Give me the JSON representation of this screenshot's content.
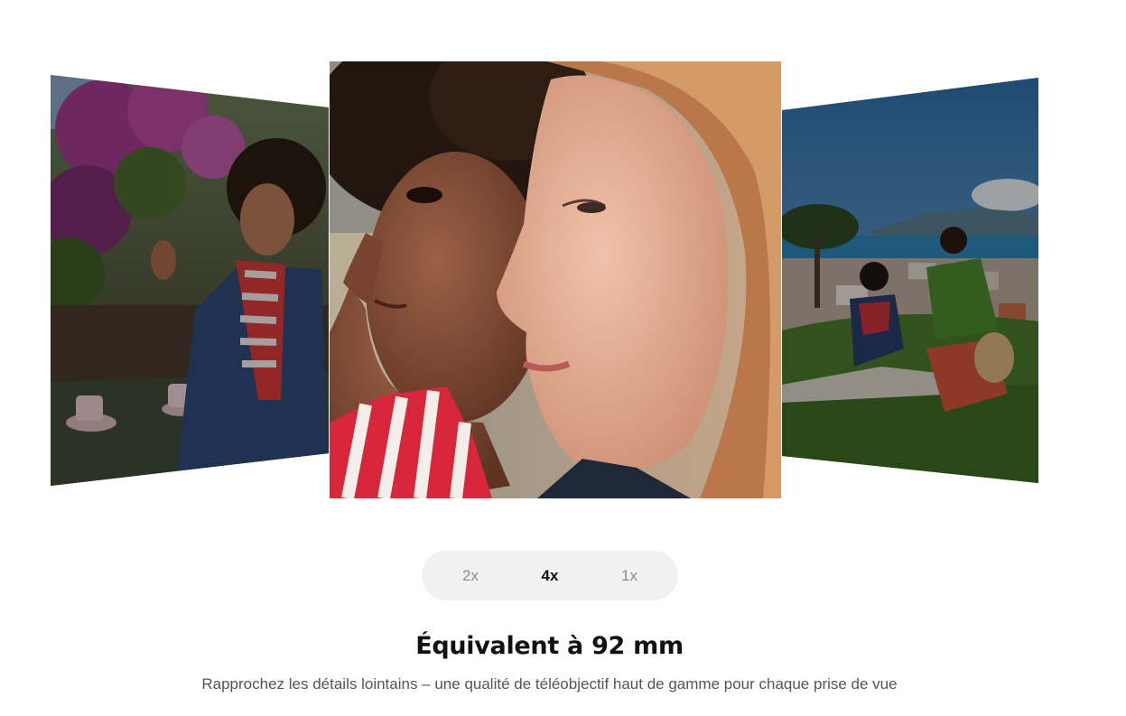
{
  "carousel": {
    "images": [
      {
        "id": "left",
        "alt": "Femme souriante à une terrasse de café avec des fleurs",
        "state": "inactive"
      },
      {
        "id": "center",
        "alt": "Deux femmes de profil en gros plan",
        "state": "active"
      },
      {
        "id": "right",
        "alt": "Groupe d'amis assis dans l'herbe au-dessus d'une ville côtière",
        "state": "inactive"
      }
    ]
  },
  "zoom": {
    "options": [
      "2x",
      "4x",
      "1x"
    ],
    "selected": "4x"
  },
  "content": {
    "title": "Équivalent à 92 mm",
    "description": "Rapprochez les détails lointains – une qualité de téléobjectif haut de gamme pour chaque prise de vue"
  },
  "colors": {
    "selector_bg": "#f1f1f1",
    "active_text": "#111111",
    "inactive_text": "#8a8a8a",
    "title": "#111111",
    "description": "#555555"
  }
}
